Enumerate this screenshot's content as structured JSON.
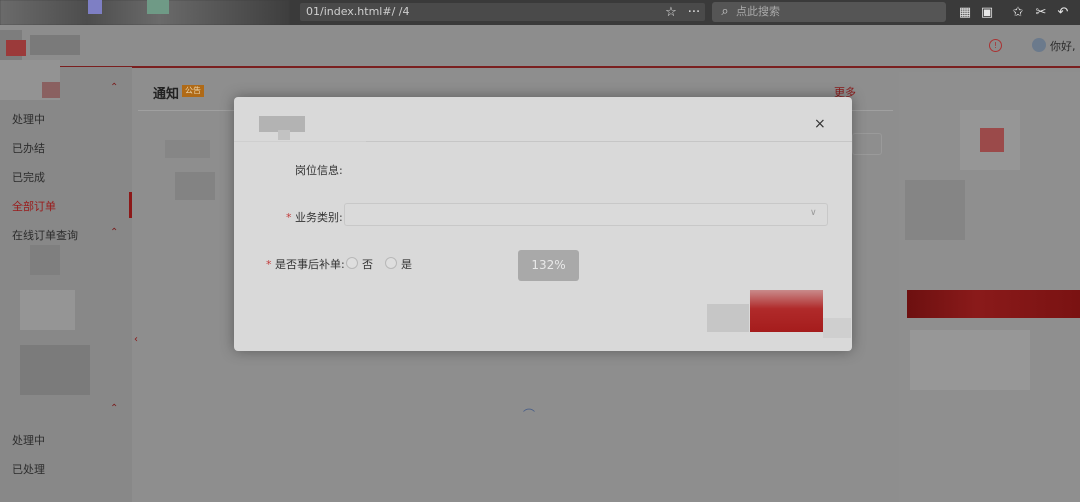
{
  "browser": {
    "url": "01/index.html#/          /4",
    "search_placeholder": "点此搜索"
  },
  "header": {
    "greeting": "你好,"
  },
  "sidebar": {
    "items": [
      {
        "label": "处理中"
      },
      {
        "label": "已办结"
      },
      {
        "label": "已完成"
      },
      {
        "label": "全部订单"
      },
      {
        "label": "在线订单查询"
      },
      {
        "label": "处理中"
      },
      {
        "label": "已处理"
      }
    ]
  },
  "notice": {
    "title": "通知",
    "badge": "公告",
    "more": "更多"
  },
  "dialog": {
    "close": "×",
    "position_label": "岗位信息:",
    "business_label": "业务类别:",
    "business_value": "",
    "supplement_label": "是否事后补单:",
    "radio_no": "否",
    "radio_yes": "是",
    "zoom": "132%"
  },
  "colors": {
    "accent": "#8c1818",
    "badge": "#b06a16",
    "overlay": "#8e8e8e",
    "dialog": "#d9d9d9"
  }
}
